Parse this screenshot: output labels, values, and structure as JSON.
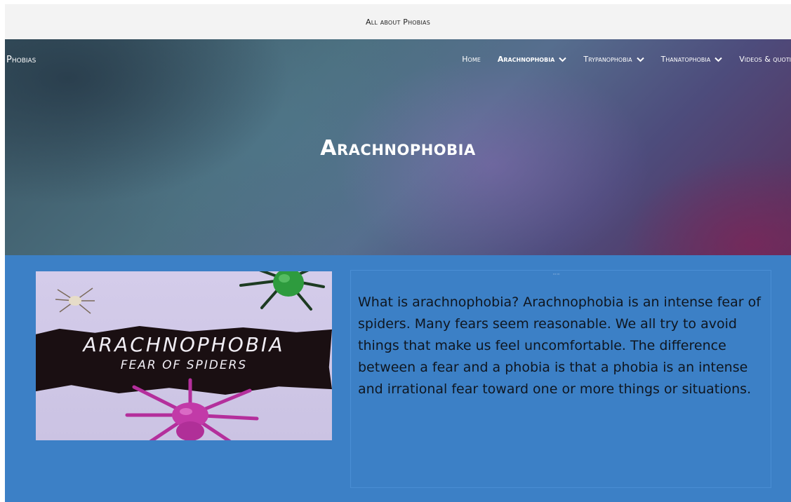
{
  "site": {
    "top_bar_text": "All about Phobias",
    "brand": "Phobias"
  },
  "nav": {
    "items": [
      {
        "label": "Home",
        "has_dropdown": false,
        "active": false
      },
      {
        "label": "Arachnophobia",
        "has_dropdown": true,
        "active": true
      },
      {
        "label": "Trypanophobia",
        "has_dropdown": true,
        "active": false
      },
      {
        "label": "Thanatophobia",
        "has_dropdown": true,
        "active": false
      },
      {
        "label": "Videos & quoti",
        "has_dropdown": false,
        "active": false
      }
    ]
  },
  "hero": {
    "title": "Arachnophobia"
  },
  "image": {
    "title": "ARACHNOPHOBIA",
    "subtitle": "FEAR OF SPIDERS"
  },
  "content": {
    "paragraph": "What is arachnophobia? Arachnophobia is an intense fear of spiders. Many fears seem reasonable. We all try to avoid things that make us feel uncomfortable. The difference between a fear and a phobia is that a phobia is an intense and irrational fear toward one or more things or situations."
  },
  "colors": {
    "top_bar": "#f3f3f3",
    "content_background": "#3c80c6",
    "nav_text": "#ffffff"
  }
}
